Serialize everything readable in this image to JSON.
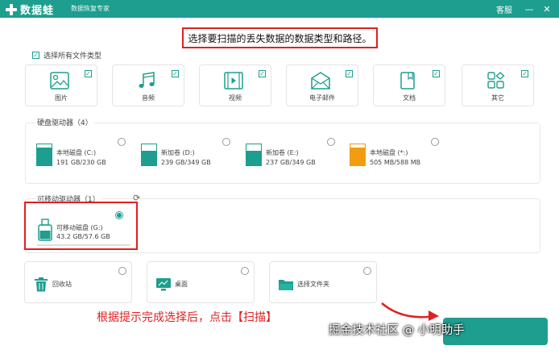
{
  "app": {
    "name": "数据蛙",
    "subtitle": "数据恢复专家",
    "service_label": "客服",
    "minimize_glyph": "—",
    "close_glyph": "✕"
  },
  "instruction": "选择要扫描的丢失数据的数据类型和路径。",
  "select_all_label": "选择所有文件类型",
  "file_types": [
    {
      "label": "图片",
      "icon": "image-icon",
      "checked": true
    },
    {
      "label": "音频",
      "icon": "music-icon",
      "checked": true
    },
    {
      "label": "视频",
      "icon": "video-icon",
      "checked": true
    },
    {
      "label": "电子邮件",
      "icon": "email-icon",
      "checked": true
    },
    {
      "label": "文档",
      "icon": "document-icon",
      "checked": true
    },
    {
      "label": "其它",
      "icon": "other-icon",
      "checked": true
    }
  ],
  "hard_drives": {
    "title": "硬盘驱动器（4）",
    "drives": [
      {
        "name": "本地磁盘 (C:)",
        "size": "191 GB/230 GB",
        "used_fraction": 0.83,
        "color": "#1d9e8e"
      },
      {
        "name": "新加卷 (D:)",
        "size": "239 GB/349 GB",
        "used_fraction": 0.68,
        "color": "#1d9e8e"
      },
      {
        "name": "新加卷 (E:)",
        "size": "237 GB/349 GB",
        "used_fraction": 0.68,
        "color": "#1d9e8e"
      },
      {
        "name": "本地磁盘 (*:)",
        "size": "505 MB/588 MB",
        "used_fraction": 0.86,
        "color": "#f39c12"
      }
    ]
  },
  "removable_drives": {
    "title": "可移动驱动器（1）",
    "refresh_glyph": "⟳",
    "drives": [
      {
        "name": "可移动磁盘 (G:)",
        "size": "43.2 GB/57.6 GB",
        "used_fraction": 0.75,
        "selected": true
      }
    ]
  },
  "locations": [
    {
      "label": "回收站",
      "icon": "recycle-bin-icon"
    },
    {
      "label": "桌面",
      "icon": "desktop-icon"
    },
    {
      "label": "选择文件夹",
      "icon": "folder-icon"
    }
  ],
  "hint": "根据提示完成选择后，点击【扫描】",
  "watermark": "掘金技术社区 @ 小明助手",
  "colors": {
    "accent": "#1d9e8e",
    "warning": "#e02020",
    "orange": "#f39c12"
  }
}
